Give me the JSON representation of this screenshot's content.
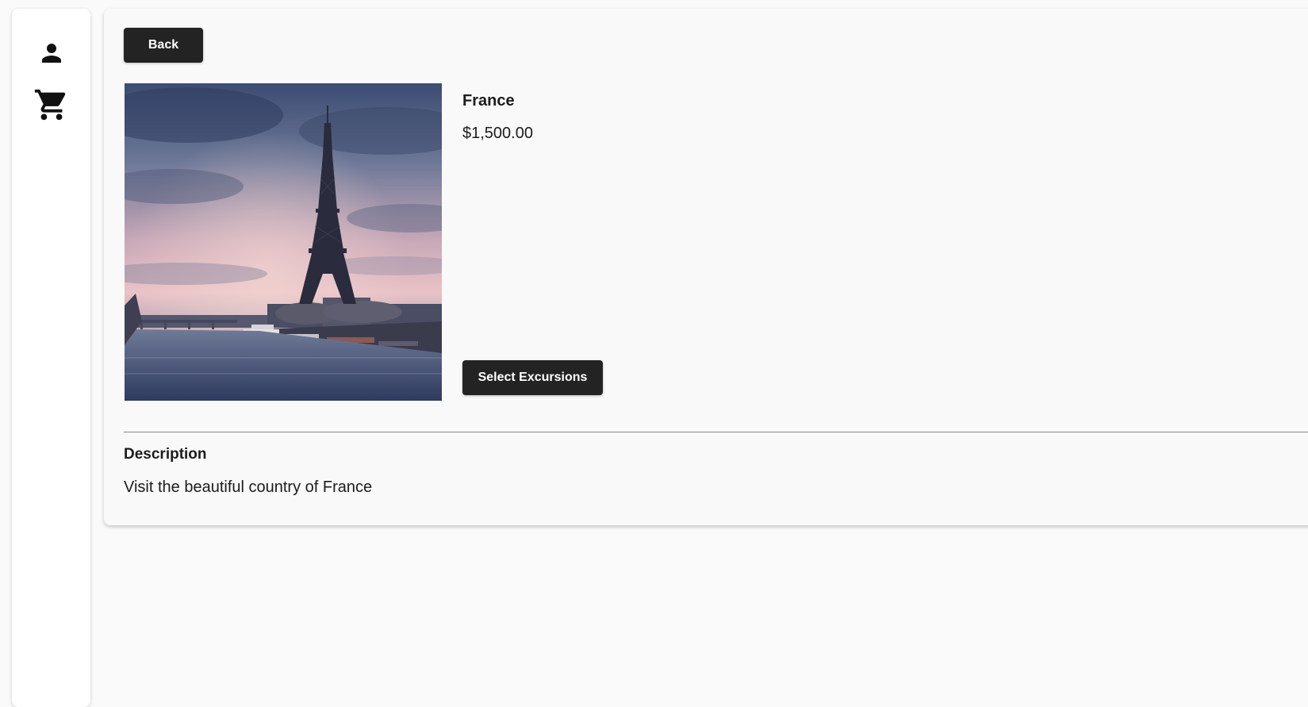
{
  "sidebar": {
    "icons": [
      {
        "name": "person-icon"
      },
      {
        "name": "cart-icon"
      }
    ]
  },
  "product": {
    "back_label": "Back",
    "title": "France",
    "price": "$1,500.00",
    "image_subject": "eiffel-tower-photo",
    "select_label": "Select Excursions",
    "description_heading": "Description",
    "description_text": "Visit the beautiful country of France"
  },
  "colors": {
    "button_bg": "#232323",
    "button_text": "#ffffff",
    "page_bg": "#fafafa",
    "card_bg": "#f9f9f9"
  }
}
